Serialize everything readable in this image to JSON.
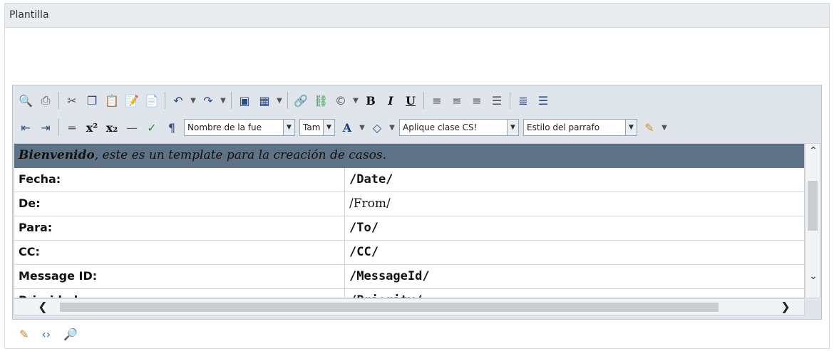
{
  "panel": {
    "title": "Plantilla"
  },
  "toolbar": {
    "font_name": "Nombre de la fue",
    "font_size": "Tam",
    "css_class": "Aplique clase CS!",
    "paragraph_style": "Estilo del parrafo"
  },
  "content": {
    "banner_bold": "Bienvenido",
    "banner_rest": ", este es un template para la creación de casos.",
    "rows": [
      {
        "label": "Fecha:",
        "value": "/Date/"
      },
      {
        "label": "De:",
        "value": "/From/"
      },
      {
        "label": "Para:",
        "value": "/To/"
      },
      {
        "label": "CC:",
        "value": "/CC/"
      },
      {
        "label": "Message ID:",
        "value": "/MessageId/"
      },
      {
        "label": "Prioridad:",
        "value": "/Priority/"
      }
    ]
  },
  "icons": {
    "row1": [
      "find-icon",
      "print-icon",
      "cut-icon",
      "copy-icon",
      "paste-icon",
      "paste-word-icon",
      "paste-text-icon",
      "undo-icon",
      "redo-icon",
      "image-icon",
      "table-icon",
      "link-icon",
      "unlink-icon",
      "symbol-icon",
      "bold-icon",
      "italic-icon",
      "underline-icon",
      "align-left-icon",
      "align-center-icon",
      "align-right-icon",
      "justify-icon",
      "ordered-list-icon",
      "bullet-list-icon"
    ],
    "row2": [
      "outdent-icon",
      "indent-icon",
      "horizontal-rule-icon",
      "superscript-icon",
      "subscript-icon",
      "strikethrough-icon",
      "spellcheck-icon",
      "paragraph-format-icon",
      "font-color-icon",
      "highlight-icon",
      "format-stripper-icon"
    ],
    "bottom": [
      "design-mode-icon",
      "html-mode-icon",
      "preview-mode-icon"
    ]
  }
}
